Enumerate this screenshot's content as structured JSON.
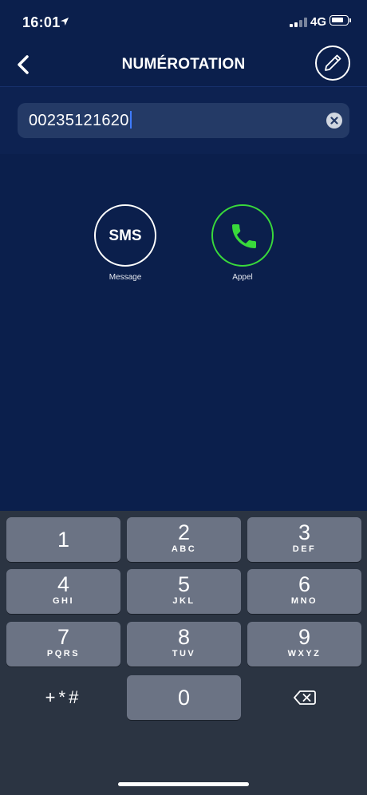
{
  "status_bar": {
    "time": "16:01",
    "network": "4G",
    "icons": [
      "location-arrow-icon",
      "signal-icon",
      "battery-icon"
    ]
  },
  "nav": {
    "title": "NUMÉROTATION",
    "icons": [
      "back-chevron-icon",
      "pencil-icon"
    ]
  },
  "dial_input": {
    "value": "00235121620",
    "clear_icon": "clear-icon"
  },
  "actions": {
    "sms": {
      "badge": "SMS",
      "label": "Message"
    },
    "call": {
      "label": "Appel",
      "icon": "phone-icon",
      "color": "#39d93b"
    }
  },
  "keypad": {
    "keys": [
      {
        "num": "1",
        "letters": ""
      },
      {
        "num": "2",
        "letters": "ABC"
      },
      {
        "num": "3",
        "letters": "DEF"
      },
      {
        "num": "4",
        "letters": "GHI"
      },
      {
        "num": "5",
        "letters": "JKL"
      },
      {
        "num": "6",
        "letters": "MNO"
      },
      {
        "num": "7",
        "letters": "PQRS"
      },
      {
        "num": "8",
        "letters": "TUV"
      },
      {
        "num": "9",
        "letters": "WXYZ"
      }
    ],
    "zero": "0",
    "symbols": "+*#"
  },
  "colors": {
    "background": "#0b1f4c",
    "field": "#243a66",
    "keyboard": "#2b3442",
    "key": "#6b7384",
    "caret": "#3f7bff"
  }
}
